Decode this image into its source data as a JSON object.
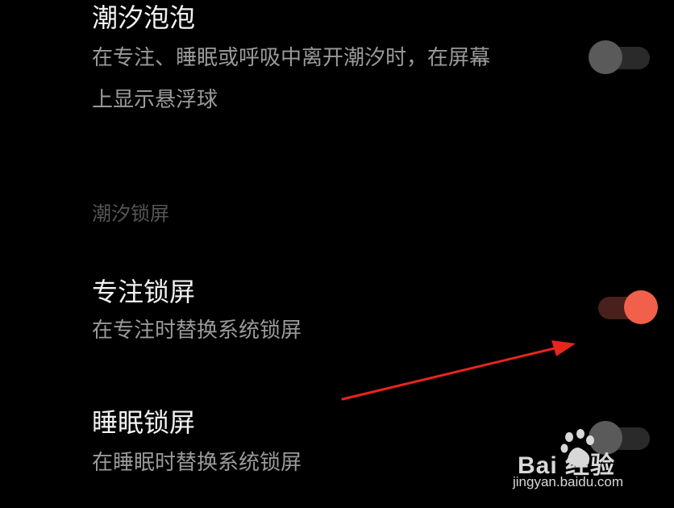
{
  "settings": {
    "tide_bubble": {
      "title": "潮汐泡泡",
      "desc_line1": "在专注、睡眠或呼吸中离开潮汐时，在屏幕",
      "desc_line2": "上显示悬浮球",
      "enabled": false
    },
    "lockscreen_section": {
      "header": "潮汐锁屏"
    },
    "focus_lock": {
      "title": "专注锁屏",
      "desc": "在专注时替换系统锁屏",
      "enabled": true
    },
    "sleep_lock": {
      "title": "睡眠锁屏",
      "desc": "在睡眠时替换系统锁屏",
      "enabled": false
    }
  },
  "colors": {
    "background": "#000000",
    "toggle_on": "#f0604a",
    "toggle_off": "#5a5a5a",
    "annotation_arrow": "#e8251c"
  },
  "watermark": {
    "logo_text": "Bai  经验",
    "url": "jingyan.baidu.com"
  }
}
